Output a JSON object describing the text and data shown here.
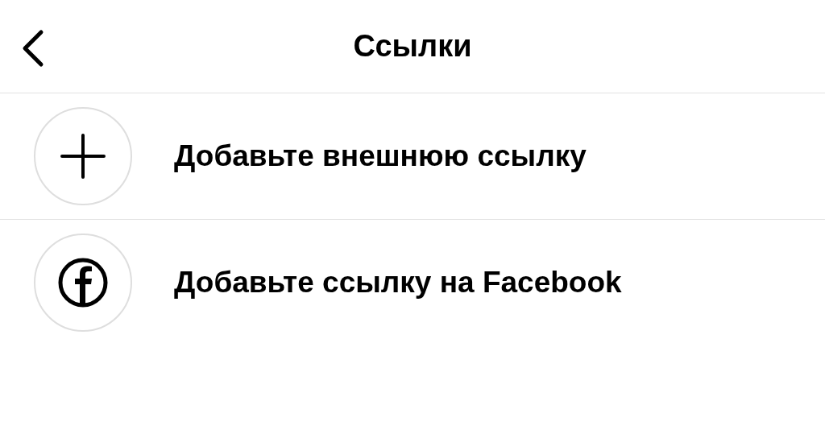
{
  "header": {
    "title": "Ссылки"
  },
  "items": [
    {
      "kind": "add",
      "label": "Добавьте внешнюю ссылку"
    },
    {
      "kind": "facebook",
      "label": "Добавьте ссылку на Facebook"
    }
  ]
}
